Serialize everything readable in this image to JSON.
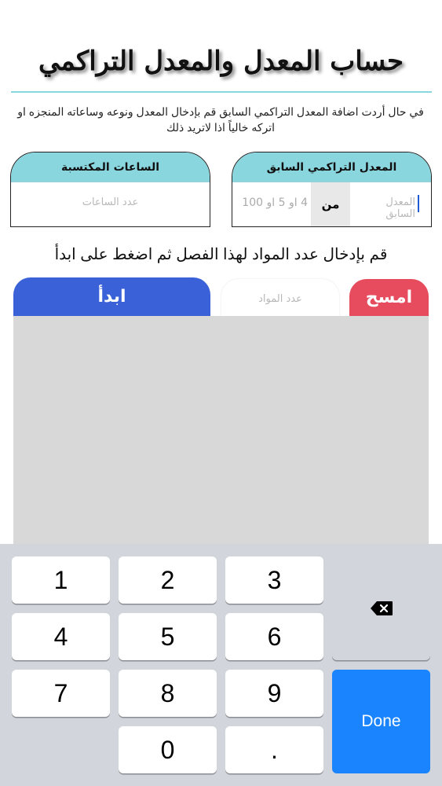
{
  "header": {
    "title": "حساب المعدل والمعدل التراكمي",
    "intro": "في حال أردت اضافة المعدل التراكمي السابق قم بإدخال المعدل ونوعه وساعاته المنجزه او اتركه خالياً اذا لاتريد ذلك"
  },
  "previous_gpa": {
    "heading": "المعدل التراكمي السابق",
    "gpa_placeholder": "المعدل السابق",
    "from_label": "من",
    "scale_placeholder": "4 او 5 او 100"
  },
  "earned_hours": {
    "heading": "الساعات المكتسبة",
    "placeholder": "عدد الساعات"
  },
  "subjects": {
    "instruction": "قم بإدخال عدد المواد لهذا الفصل ثم اضغط على ابدأ",
    "clear_label": "امسح",
    "count_placeholder": "عدد المواد",
    "start_label": "ابدأ"
  },
  "keyboard": {
    "keys": [
      "1",
      "2",
      "3",
      "4",
      "5",
      "6",
      "7",
      "8",
      "9",
      "0",
      "."
    ],
    "done_label": "Done"
  },
  "colors": {
    "card_header": "#8ad6df",
    "clear_button": "#e64b5e",
    "start_button": "#3a61d8",
    "done_key": "#1a84ff"
  }
}
